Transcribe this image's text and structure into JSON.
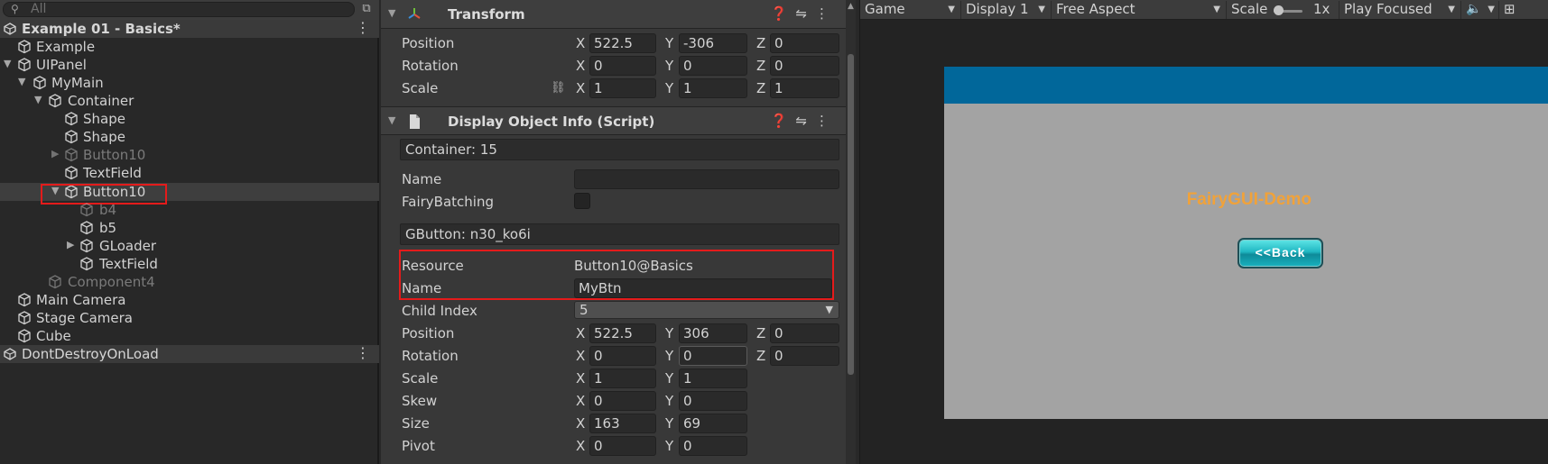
{
  "hierarchy": {
    "search_placeholder": "All",
    "scene_title": "Example 01 - Basics*",
    "items": [
      {
        "label": "Example"
      },
      {
        "label": "UIPanel"
      },
      {
        "label": "MyMain"
      },
      {
        "label": "Container"
      },
      {
        "label": "Shape"
      },
      {
        "label": "Shape"
      },
      {
        "label": "Button10"
      },
      {
        "label": "TextField"
      },
      {
        "label": "Button10"
      },
      {
        "label": "b4"
      },
      {
        "label": "b5"
      },
      {
        "label": "GLoader"
      },
      {
        "label": "TextField"
      },
      {
        "label": "Component4"
      },
      {
        "label": "Main Camera"
      },
      {
        "label": "Stage Camera"
      },
      {
        "label": "Cube"
      }
    ],
    "dont_destroy": "DontDestroyOnLoad"
  },
  "inspector": {
    "transform": {
      "title": "Transform",
      "position": {
        "label": "Position",
        "x": "522.5",
        "y": "-306",
        "z": "0"
      },
      "rotation": {
        "label": "Rotation",
        "x": "0",
        "y": "0",
        "z": "0"
      },
      "scale": {
        "label": "Scale",
        "x": "1",
        "y": "1",
        "z": "1"
      }
    },
    "display_info": {
      "title": "Display Object Info (Script)",
      "container_text": "Container: 15",
      "name_label": "Name",
      "name_value": "",
      "fairy_batching_label": "FairyBatching",
      "fairy_batching_checked": false,
      "gbutton_text": "GButton: n30_ko6i",
      "resource_label": "Resource",
      "resource_value": "Button10@Basics",
      "gname_label": "Name",
      "gname_value": "MyBtn",
      "child_index_label": "Child Index",
      "child_index_value": "5",
      "position": {
        "label": "Position",
        "x": "522.5",
        "y": "306",
        "z": "0"
      },
      "rotation": {
        "label": "Rotation",
        "x": "0",
        "y": "0",
        "z": "0"
      },
      "scale": {
        "label": "Scale",
        "x": "1",
        "y": "1"
      },
      "skew": {
        "label": "Skew",
        "x": "0",
        "y": "0"
      },
      "size": {
        "label": "Size",
        "x": "163",
        "y": "69"
      },
      "pivot": {
        "label": "Pivot",
        "x": "0",
        "y": "0"
      }
    },
    "axis": {
      "x": "X",
      "y": "Y",
      "z": "Z"
    }
  },
  "game": {
    "tab": "Game",
    "display": "Display 1",
    "aspect": "Free Aspect",
    "scale_label": "Scale",
    "scale_value": "1x",
    "play_mode": "Play Focused",
    "demo_title": "FairyGUI-Demo",
    "back_button": "<<Back"
  },
  "colors": {
    "highlight_red": "#e41b1b",
    "game_header_blue": "#01679a",
    "demo_title_orange": "#f0a23a",
    "button_teal": "#20b7c2"
  }
}
